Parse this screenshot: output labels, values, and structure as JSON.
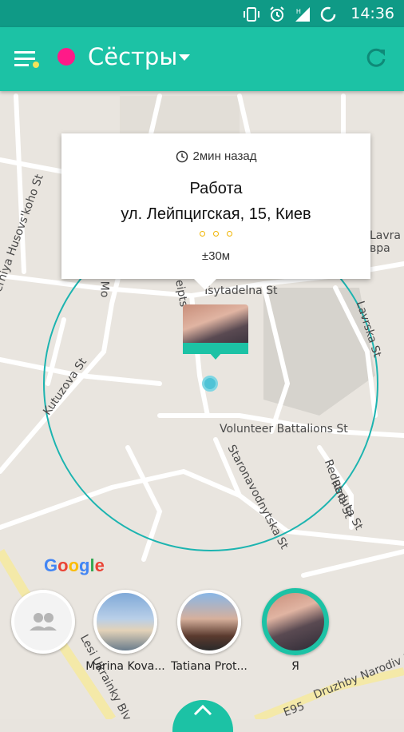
{
  "status_bar": {
    "time": "14:36",
    "icons": [
      "vibrate-icon",
      "alarm-icon",
      "signal-h-icon",
      "battery-icon"
    ]
  },
  "app_bar": {
    "title": "Сёстры",
    "group_color": "#ff1a88",
    "accent": "#1cc2a5"
  },
  "map": {
    "labels": [
      "Serhiya Husovs'koho St",
      "Tsytadelna St",
      "Kutuzova St",
      "Volunteer Battalions St",
      "Staronavodnytska St",
      "Redutna St",
      "Reduta St",
      "Lavrska St",
      "Lesi Ukrainky Blvd",
      "Druzhby Narodiv Blvd",
      "E95",
      "Mo",
      "eipts",
      "Lavra",
      "вра"
    ],
    "google_logo": "Google"
  },
  "popup": {
    "time_ago": "2мин назад",
    "place": "Работа",
    "address": "ул. Лейпцигская, 15, Киев",
    "accuracy": "±30м"
  },
  "members": [
    {
      "label": "Marina Kova..."
    },
    {
      "label": "Tatiana Prot..."
    },
    {
      "label": "Я"
    }
  ]
}
